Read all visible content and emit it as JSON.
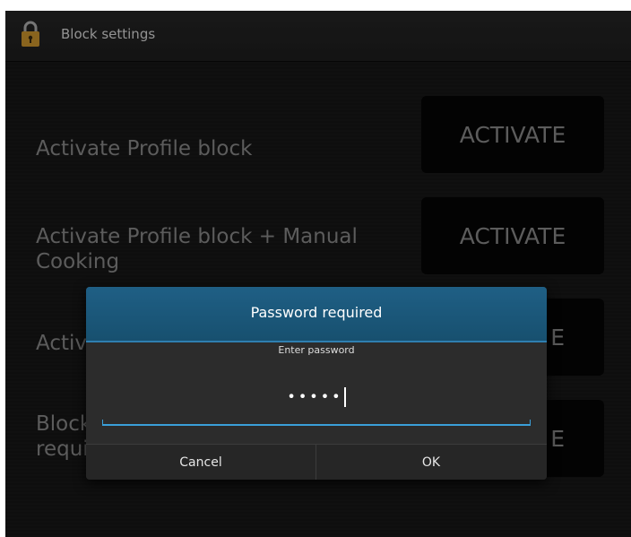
{
  "titlebar": {
    "title": "Block settings",
    "icon": "lock-icon"
  },
  "rows": [
    {
      "label": "Activate Profile block",
      "button": "ACTIVATE"
    },
    {
      "label": "Activate Profile block + Manual Cooking",
      "button": "ACTIVATE"
    },
    {
      "label": "Activ",
      "button": "E"
    },
    {
      "label": "Block requi",
      "button": "E"
    }
  ],
  "dialog": {
    "title": "Password required",
    "message": "Enter password",
    "password_masked": "•••••",
    "cancel_label": "Cancel",
    "ok_label": "OK"
  },
  "colors": {
    "dialog_header": "#1f5f85",
    "accent": "#3a9fd9",
    "lock_icon": "#d39a2e"
  }
}
